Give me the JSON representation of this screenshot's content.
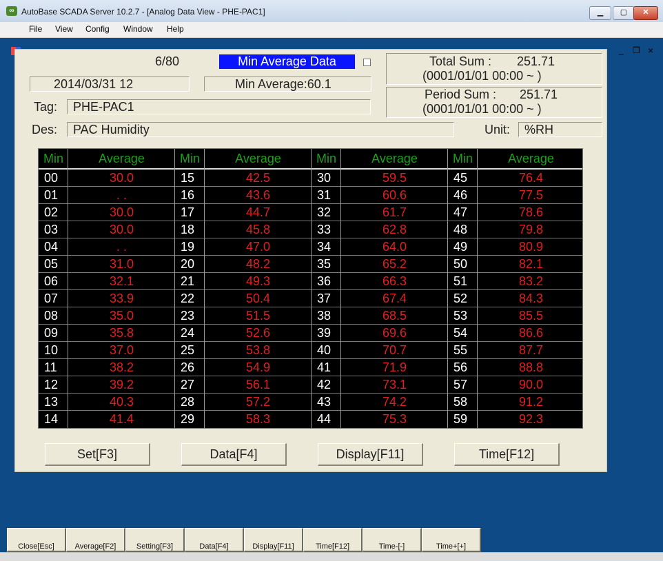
{
  "window": {
    "title": "AutoBase SCADA Server 10.2.7 - [Analog Data View - PHE-PAC1]",
    "icon": "autobase-app-icon"
  },
  "menu": [
    "File",
    "View",
    "Config",
    "Window",
    "Help"
  ],
  "info": {
    "page": "6/80",
    "mode": "Min Average Data",
    "date": "2014/03/31 12",
    "min_average": "Min Average:60.1",
    "total_sum_label": "Total Sum :",
    "total_sum_value": "251.71",
    "total_sum_range": "(0001/01/01 00:00 ~ )",
    "period_sum_label": "Period Sum :",
    "period_sum_value": "251.71",
    "period_sum_range": "(0001/01/01 00:00 ~ )",
    "tag_label": "Tag:",
    "tag": "PHE-PAC1",
    "des_label": "Des:",
    "des": "PAC Humidity",
    "unit_label": "Unit:",
    "unit": "%RH"
  },
  "table": {
    "min_header": "Min",
    "avg_header": "Average",
    "columns": [
      [
        [
          "00",
          "30.0"
        ],
        [
          "01",
          ". ."
        ],
        [
          "02",
          "30.0"
        ],
        [
          "03",
          "30.0"
        ],
        [
          "04",
          ". ."
        ],
        [
          "05",
          "31.0"
        ],
        [
          "06",
          "32.1"
        ],
        [
          "07",
          "33.9"
        ],
        [
          "08",
          "35.0"
        ],
        [
          "09",
          "35.8"
        ],
        [
          "10",
          "37.0"
        ],
        [
          "11",
          "38.2"
        ],
        [
          "12",
          "39.2"
        ],
        [
          "13",
          "40.3"
        ],
        [
          "14",
          "41.4"
        ]
      ],
      [
        [
          "15",
          "42.5"
        ],
        [
          "16",
          "43.6"
        ],
        [
          "17",
          "44.7"
        ],
        [
          "18",
          "45.8"
        ],
        [
          "19",
          "47.0"
        ],
        [
          "20",
          "48.2"
        ],
        [
          "21",
          "49.3"
        ],
        [
          "22",
          "50.4"
        ],
        [
          "23",
          "51.5"
        ],
        [
          "24",
          "52.6"
        ],
        [
          "25",
          "53.8"
        ],
        [
          "26",
          "54.9"
        ],
        [
          "27",
          "56.1"
        ],
        [
          "28",
          "57.2"
        ],
        [
          "29",
          "58.3"
        ]
      ],
      [
        [
          "30",
          "59.5"
        ],
        [
          "31",
          "60.6"
        ],
        [
          "32",
          "61.7"
        ],
        [
          "33",
          "62.8"
        ],
        [
          "34",
          "64.0"
        ],
        [
          "35",
          "65.2"
        ],
        [
          "36",
          "66.3"
        ],
        [
          "37",
          "67.4"
        ],
        [
          "38",
          "68.5"
        ],
        [
          "39",
          "69.6"
        ],
        [
          "40",
          "70.7"
        ],
        [
          "41",
          "71.9"
        ],
        [
          "42",
          "73.1"
        ],
        [
          "43",
          "74.2"
        ],
        [
          "44",
          "75.3"
        ]
      ],
      [
        [
          "45",
          "76.4"
        ],
        [
          "46",
          "77.5"
        ],
        [
          "47",
          "78.6"
        ],
        [
          "48",
          "79.8"
        ],
        [
          "49",
          "80.9"
        ],
        [
          "50",
          "82.1"
        ],
        [
          "51",
          "83.2"
        ],
        [
          "52",
          "84.3"
        ],
        [
          "53",
          "85.5"
        ],
        [
          "54",
          "86.6"
        ],
        [
          "55",
          "87.7"
        ],
        [
          "56",
          "88.8"
        ],
        [
          "57",
          "90.0"
        ],
        [
          "58",
          "91.2"
        ],
        [
          "59",
          "92.3"
        ]
      ]
    ]
  },
  "buttons": {
    "set": "Set[F3]",
    "data": "Data[F4]",
    "display": "Display[F11]",
    "time": "Time[F12]"
  },
  "bottom": [
    "Close[Esc]",
    "Average[F2]",
    "Setting[F3]",
    "Data[F4]",
    "Display[F11]",
    "Time[F12]",
    "Time-[-]",
    "Time+[+]"
  ],
  "colors": {
    "background": "#0e4a86",
    "panel": "#ece9d8",
    "mode_highlight": "#0a14ff",
    "header_text": "#1aa01a",
    "value_text": "#e02020"
  }
}
